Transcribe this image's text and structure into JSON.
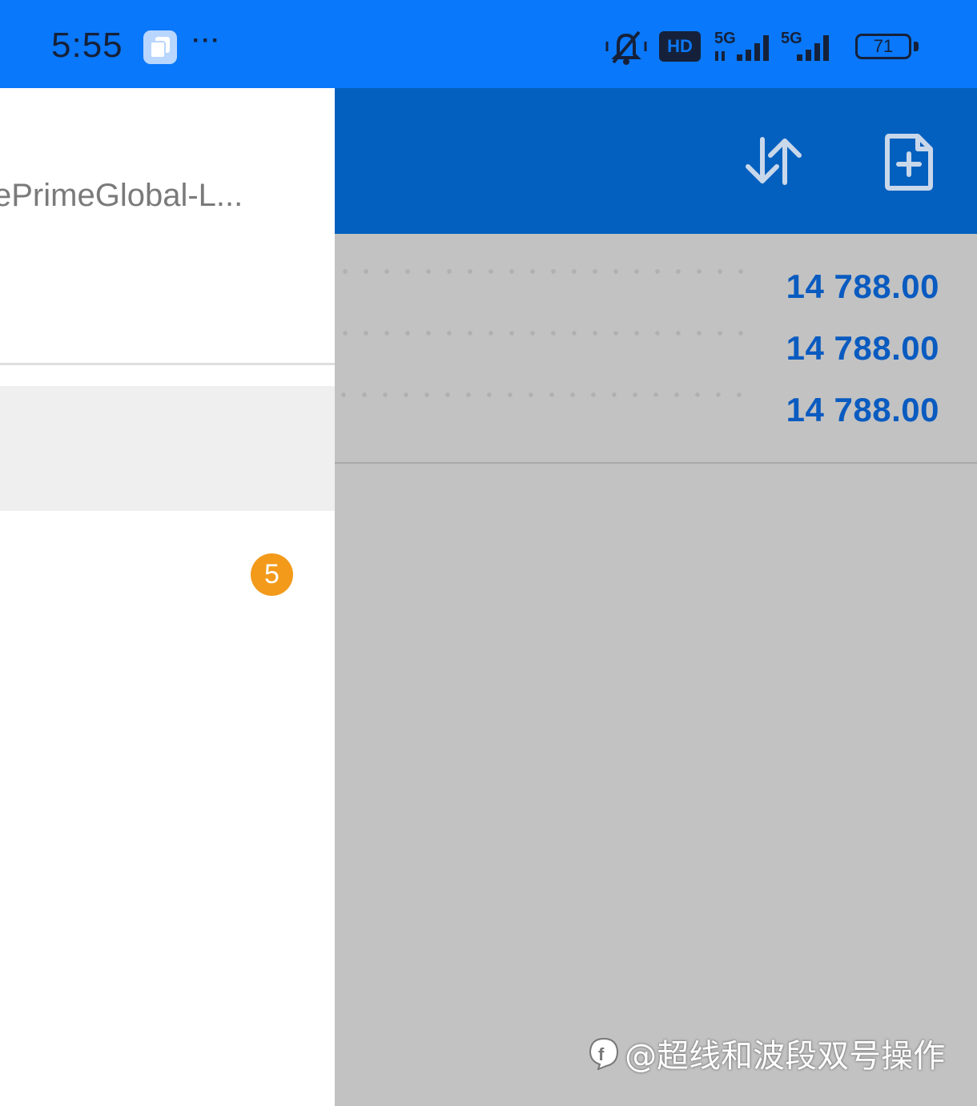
{
  "status_bar": {
    "time": "5:55",
    "more_icon": "more-dots",
    "hd_label": "HD",
    "signal_1_label": "5G",
    "signal_2_label": "5G",
    "battery_level": "71",
    "app_icon": "app-window-icon",
    "silent_icon": "bell-off"
  },
  "drawer": {
    "server_name": "ePrimeGlobal-L...",
    "notification_count": "5",
    "badge_color": "#f39a1b"
  },
  "toolbar": {
    "sort_icon": "sort-arrows",
    "add_icon": "file-add"
  },
  "quotes": {
    "rows": [
      {
        "value": "14 788.00"
      },
      {
        "value": "14 788.00"
      },
      {
        "value": "14 788.00"
      }
    ],
    "value_color": "#0a5bc0"
  },
  "watermark": {
    "text": "@超线和波段双号操作"
  },
  "colors": {
    "status_bar": "#0a78fa",
    "app_bar": "#0360bf",
    "overlay": "#c2c2c2"
  }
}
